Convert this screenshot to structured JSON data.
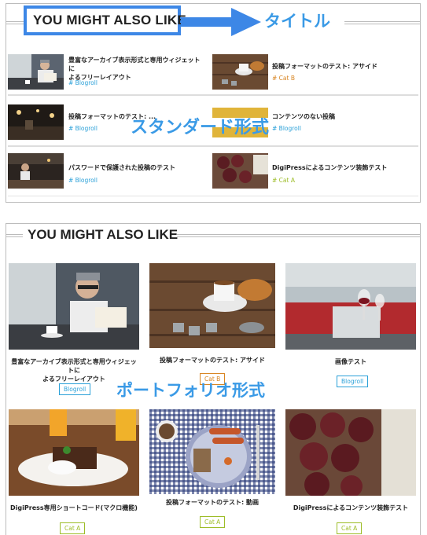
{
  "section_title": "YOU MIGHT ALSO LIKE",
  "annotations": {
    "title": "タイトル",
    "standard": "スタンダード形式",
    "portfolio": "ポートフォリオ形式"
  },
  "colors": {
    "annotation_blue": "#3a9ae6",
    "box_blue": "#3d87e6",
    "blogroll": "#2aa0d8",
    "cat_b": "#d88522",
    "cat_a": "#9dbd28"
  },
  "standard_items": [
    {
      "title": "豊富なアーカイブ表示形式と専用ウィジェットに\nよるフリーレイアウト",
      "tag": "# Blogroll",
      "tag_color": "blogroll",
      "image": "man-reading-photo"
    },
    {
      "title": "投稿フォーマットのテスト: アサイド",
      "tag": "# Cat B",
      "tag_color": "cat_b",
      "image": "coffee-croissant-photo"
    },
    {
      "title": "投稿フォーマットのテスト: ...",
      "tag": "# Blogroll",
      "tag_color": "blogroll",
      "image": "night-cafe-photo"
    },
    {
      "title": "コンテンツのない投稿",
      "tag": "# Blogroll",
      "tag_color": "blogroll",
      "image": "yellow-placeholder"
    },
    {
      "title": "パスワードで保護された投稿のテスト",
      "tag": "# Blogroll",
      "tag_color": "blogroll",
      "image": "bar-photo"
    },
    {
      "title": "DigiPressによるコンテンツ装飾テスト",
      "tag": "# Cat A",
      "tag_color": "cat_a",
      "image": "muffins-photo"
    }
  ],
  "portfolio_items": [
    {
      "title": "豊富なアーカイブ表示形式と専用ウィジェットに\nよるフリーレイアウト",
      "tag": "Blogroll",
      "tag_color": "blogroll",
      "image": "man-reading-photo"
    },
    {
      "title": "投稿フォーマットのテスト: アサイド",
      "tag": "Cat B",
      "tag_color": "cat_b",
      "image": "coffee-croissant-photo"
    },
    {
      "title": "画像テスト",
      "tag": "Blogroll",
      "tag_color": "blogroll",
      "image": "wine-terrace-photo"
    },
    {
      "title": "DigiPress専用ショートコード(マクロ機能)",
      "tag": "Cat A",
      "tag_color": "cat_a",
      "image": "cake-juice-photo"
    },
    {
      "title": "投稿フォーマットのテスト: 動画",
      "tag": "Cat A",
      "tag_color": "cat_a",
      "image": "sausage-bread-photo"
    },
    {
      "title": "DigiPressによるコンテンツ装飾テスト",
      "tag": "Cat A",
      "tag_color": "cat_a",
      "image": "muffins-photo"
    }
  ]
}
